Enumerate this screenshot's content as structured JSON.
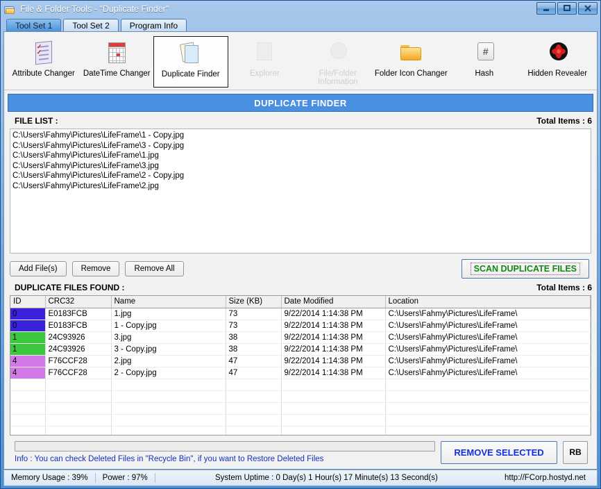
{
  "window": {
    "title": "File & Folder Tools - \"Duplicate Finder\"",
    "icon": "folder-icon",
    "minimize_label": "minimize-icon",
    "maximize_label": "maximize-icon",
    "close_label": "close-icon"
  },
  "tabs": [
    {
      "label": "Tool Set 1",
      "active": true
    },
    {
      "label": "Tool Set 2",
      "active": false
    },
    {
      "label": "Program Info",
      "active": false
    }
  ],
  "toolbar": {
    "items": [
      {
        "label": "Attribute Changer",
        "icon": "attribute-changer-icon",
        "state": "normal"
      },
      {
        "label": "DateTime Changer",
        "icon": "calendar-icon",
        "state": "normal"
      },
      {
        "label": "Duplicate Finder",
        "icon": "duplicate-pages-icon",
        "state": "selected"
      },
      {
        "label": "Explorer",
        "icon": "explorer-icon",
        "state": "disabled"
      },
      {
        "label": "File/Folder Information",
        "icon": "file-folder-info-icon",
        "state": "disabled"
      },
      {
        "label": "Folder Icon Changer",
        "icon": "open-folder-icon",
        "state": "normal"
      },
      {
        "label": "Hash",
        "icon": "hash-icon",
        "state": "normal"
      },
      {
        "label": "Hidden Revealer",
        "icon": "hidden-revealer-icon",
        "state": "normal"
      }
    ]
  },
  "banner": {
    "title": "DUPLICATE FINDER",
    "color": "#4a90e2"
  },
  "file_list": {
    "label": "FILE LIST :",
    "total_items": "Total Items : 6",
    "items": [
      "C:\\Users\\Fahmy\\Pictures\\LifeFrame\\1 - Copy.jpg",
      "C:\\Users\\Fahmy\\Pictures\\LifeFrame\\3 - Copy.jpg",
      "C:\\Users\\Fahmy\\Pictures\\LifeFrame\\1.jpg",
      "C:\\Users\\Fahmy\\Pictures\\LifeFrame\\3.jpg",
      "C:\\Users\\Fahmy\\Pictures\\LifeFrame\\2 - Copy.jpg",
      "C:\\Users\\Fahmy\\Pictures\\LifeFrame\\2.jpg"
    ]
  },
  "actions": {
    "add_files": "Add File(s)",
    "remove": "Remove",
    "remove_all": "Remove All",
    "scan": "SCAN DUPLICATE FILES",
    "scan_color": "#118811"
  },
  "results": {
    "label": "DUPLICATE FILES FOUND :",
    "total_items": "Total Items : 6",
    "columns": [
      "ID",
      "CRC32",
      "Name",
      "Size (KB)",
      "Date Modified",
      "Location"
    ],
    "rows": [
      {
        "id": "0",
        "crc32": "E0183FCB",
        "name": "1.jpg",
        "size": "73",
        "date": "9/22/2014 1:14:38 PM",
        "location": "C:\\Users\\Fahmy\\Pictures\\LifeFrame\\",
        "color": "#3a22dc"
      },
      {
        "id": "0",
        "crc32": "E0183FCB",
        "name": "1 - Copy.jpg",
        "size": "73",
        "date": "9/22/2014 1:14:38 PM",
        "location": "C:\\Users\\Fahmy\\Pictures\\LifeFrame\\",
        "color": "#3a22dc"
      },
      {
        "id": "1",
        "crc32": "24C93926",
        "name": "3.jpg",
        "size": "38",
        "date": "9/22/2014 1:14:38 PM",
        "location": "C:\\Users\\Fahmy\\Pictures\\LifeFrame\\",
        "color": "#3cc83c"
      },
      {
        "id": "1",
        "crc32": "24C93926",
        "name": "3 - Copy.jpg",
        "size": "38",
        "date": "9/22/2014 1:14:38 PM",
        "location": "C:\\Users\\Fahmy\\Pictures\\LifeFrame\\",
        "color": "#3cc83c"
      },
      {
        "id": "4",
        "crc32": "F76CCF28",
        "name": "2.jpg",
        "size": "47",
        "date": "9/22/2014 1:14:38 PM",
        "location": "C:\\Users\\Fahmy\\Pictures\\LifeFrame\\",
        "color": "#d478e8"
      },
      {
        "id": "4",
        "crc32": "F76CCF28",
        "name": "2 - Copy.jpg",
        "size": "47",
        "date": "9/22/2014 1:14:38 PM",
        "location": "C:\\Users\\Fahmy\\Pictures\\LifeFrame\\",
        "color": "#d478e8"
      }
    ],
    "empty_rows": 5
  },
  "bottom": {
    "progress_percent": 0,
    "info": "Info : You can check Deleted Files in \"Recycle Bin\", if you want to Restore Deleted Files",
    "remove_selected": "REMOVE SELECTED",
    "recycle_bin": "RB"
  },
  "statusbar": {
    "memory": "Memory Usage : 39%",
    "power": "Power : 97%",
    "uptime": "System Uptime : 0 Day(s) 1 Hour(s) 17 Minute(s) 13 Second(s)",
    "url": "http://FCorp.hostyd.net"
  }
}
